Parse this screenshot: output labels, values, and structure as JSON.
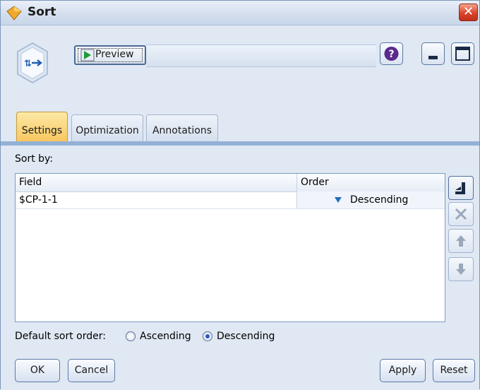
{
  "window": {
    "title": "Sort",
    "close_glyph": "✕"
  },
  "toolbar": {
    "preview_label": "Preview",
    "help_glyph": "?"
  },
  "tabs": [
    {
      "label": "Settings",
      "active": true
    },
    {
      "label": "Optimization",
      "active": false
    },
    {
      "label": "Annotations",
      "active": false
    }
  ],
  "settings": {
    "sort_by_label": "Sort by:",
    "columns": [
      "Field",
      "Order"
    ],
    "rows": [
      {
        "field": "$CP-1-1",
        "order": "Descending"
      }
    ],
    "default_order_label": "Default sort order:",
    "radio_options": [
      {
        "label": "Ascending",
        "checked": false
      },
      {
        "label": "Descending",
        "checked": true
      }
    ]
  },
  "buttons": {
    "ok": "OK",
    "cancel": "Cancel",
    "apply": "Apply",
    "reset": "Reset"
  },
  "colors": {
    "active_tab": "#f8c55b",
    "close_button": "#d9442a",
    "accent": "#2a58c7"
  }
}
